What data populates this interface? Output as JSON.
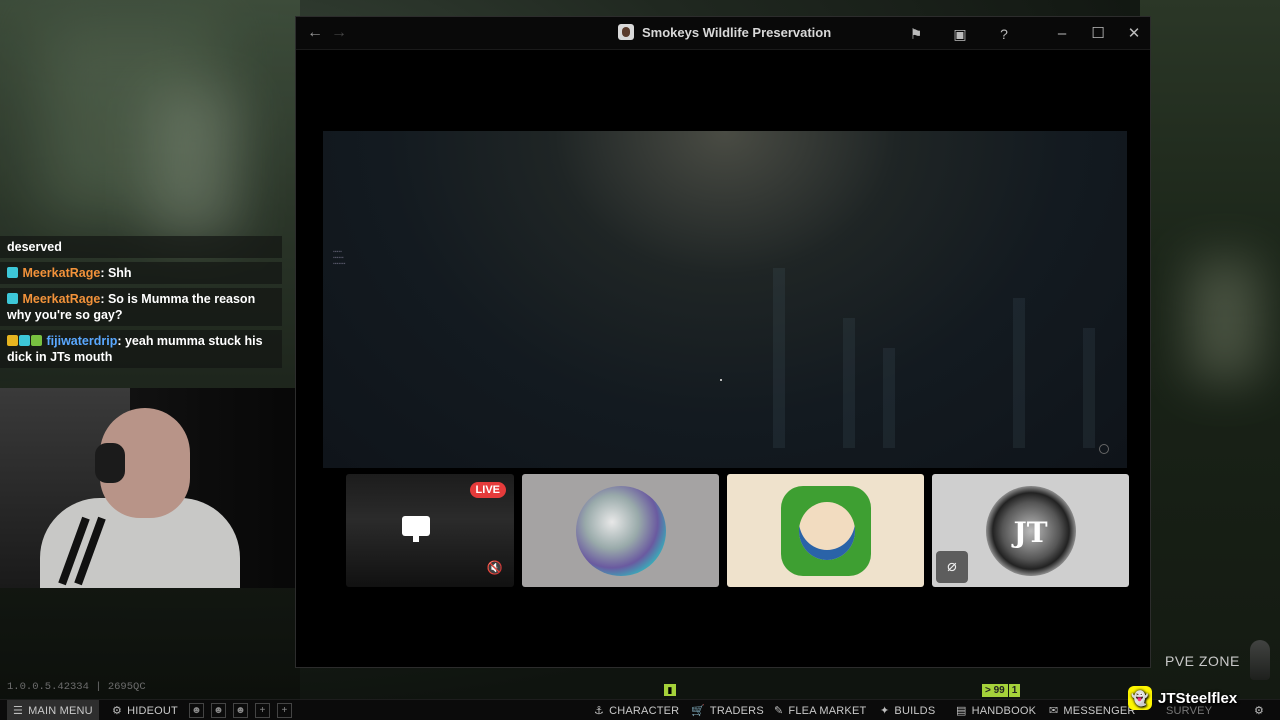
{
  "window": {
    "title": "Smokeys Wildlife Preservation",
    "back_icon": "arrow-left-icon",
    "forward_icon": "arrow-right-icon",
    "actions": [
      "flag-icon",
      "inbox-icon",
      "help-icon"
    ],
    "controls": [
      "minimize-icon",
      "maximize-icon",
      "close-icon"
    ]
  },
  "chat": {
    "messages": [
      {
        "user": "",
        "text": "deserved"
      },
      {
        "user": "MeerkatRage",
        "text": ": Shh"
      },
      {
        "user": "MeerkatRage",
        "text": ": So is Mumma the reason why you're so gay?"
      },
      {
        "user": "fijiwaterdrip",
        "text": ": yeah mumma stuck his dick in JTs mouth"
      }
    ]
  },
  "tiles": {
    "stream_badge": "LIVE",
    "avatar_4_letters": "JT"
  },
  "pve_zone": "PVE ZONE",
  "version": "1.0.0.5.42334 | 2695QC",
  "indicators": {
    "left": "",
    "right_a": "> 99",
    "right_b": "1"
  },
  "bottom_bar": {
    "main_menu": "MAIN MENU",
    "hideout": "HIDEOUT",
    "character": "CHARACTER",
    "traders": "TRADERS",
    "flea_market": "FLEA MARKET",
    "builds": "BUILDS",
    "handbook": "HANDBOOK",
    "messenger": "MESSENGER",
    "survey": "SURVEY"
  },
  "streamer": {
    "name": "JTSteelflex"
  },
  "colors": {
    "live": "#e53b3b",
    "user_orange": "#f2923a",
    "user_blue": "#5aa8ff",
    "indicator_green": "#a5d23a",
    "snapchat_yellow": "#fff700"
  }
}
